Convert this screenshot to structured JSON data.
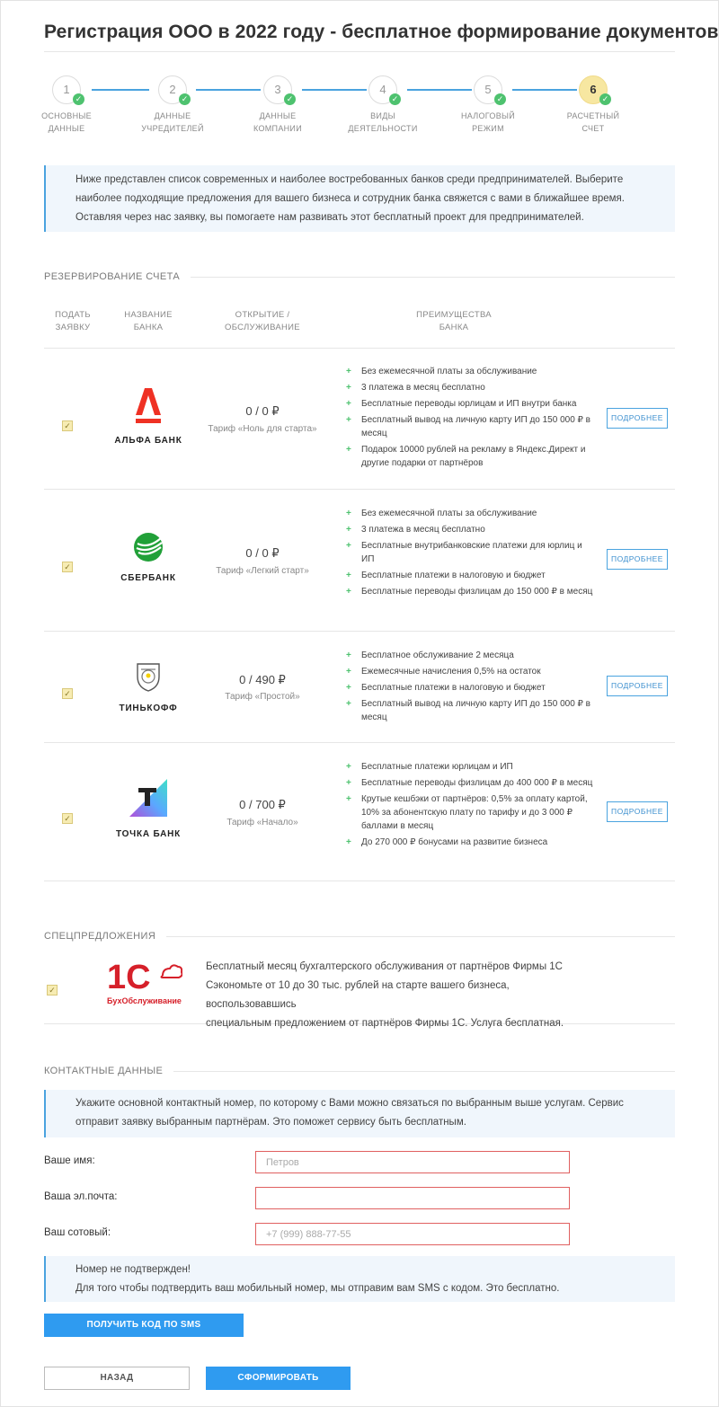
{
  "page": {
    "title": "Регистрация ООО в 2022 году - бесплатное формирование документов"
  },
  "steps": [
    {
      "num": "1",
      "label_1": "ОСНОВНЫЕ",
      "label_2": "ДАННЫЕ",
      "done": true
    },
    {
      "num": "2",
      "label_1": "ДАННЫЕ",
      "label_2": "УЧРЕДИТЕЛЕЙ",
      "done": true
    },
    {
      "num": "3",
      "label_1": "ДАННЫЕ",
      "label_2": "КОМПАНИИ",
      "done": true
    },
    {
      "num": "4",
      "label_1": "ВИДЫ",
      "label_2": "ДЕЯТЕЛЬНОСТИ",
      "done": true
    },
    {
      "num": "5",
      "label_1": "НАЛОГОВЫЙ",
      "label_2": "РЕЖИМ",
      "done": true
    },
    {
      "num": "6",
      "label_1": "РАСЧЕТНЫЙ",
      "label_2": "СЧЕТ",
      "done": true,
      "active": true
    }
  ],
  "intro": {
    "line_1": "Ниже представлен список современных и наиболее востребованных банков среди предпринимателей. Выберите",
    "line_2": "наиболее подходящие предложения для вашего бизнеса и сотрудник банка свяжется с вами в ближайшее время.",
    "line_3": "Оставляя через нас заявку, вы помогаете нам развивать этот бесплатный проект для предпринимателей."
  },
  "reservation": {
    "heading": "РЕЗЕРВИРОВАНИЕ СЧЕТА",
    "columns": {
      "apply_1": "ПОДАТЬ",
      "apply_2": "ЗАЯВКУ",
      "bank_1": "НАЗВАНИЕ",
      "bank_2": "БАНКА",
      "open_1": "ОТКРЫТИЕ /",
      "open_2": "ОБСЛУЖИВАНИЕ",
      "adv_1": "ПРЕИМУЩЕСТВА",
      "adv_2": "БАНКА"
    },
    "more_label": "ПОДРОБНЕЕ",
    "banks": [
      {
        "name": "АЛЬФА БАНК",
        "logo_icon": "alfa-bank-logo",
        "price": "0 / 0 ₽",
        "tariff": "Тариф «Ноль для старта»",
        "checked": true,
        "advantages": [
          "Без ежемесячной платы за обслуживание",
          "3 платежа в месяц бесплатно",
          "Бесплатные переводы юрлицам и ИП внутри банка",
          "Бесплатный вывод на личную карту ИП до 150 000 ₽ в месяц",
          "Подарок 10000 рублей на рекламу в Яндекс.Директ и другие подарки от партнёров"
        ]
      },
      {
        "name": "СБЕРБАНК",
        "logo_icon": "sberbank-logo",
        "price": "0 / 0 ₽",
        "tariff": "Тариф «Легкий старт»",
        "checked": true,
        "advantages": [
          "Без ежемесячной платы за обслуживание",
          "3 платежа в месяц бесплатно",
          "Бесплатные внутрибанковские платежи для юрлиц и ИП",
          "Бесплатные платежи в налоговую и бюджет",
          "Бесплатные переводы физлицам до 150 000 ₽ в месяц"
        ]
      },
      {
        "name": "ТИНЬКОФФ",
        "logo_icon": "tinkoff-logo",
        "price": "0 / 490 ₽",
        "tariff": "Тариф «Простой»",
        "checked": true,
        "advantages": [
          "Бесплатное обслуживание 2 месяца",
          "Ежемесячные начисления 0,5% на остаток",
          "Бесплатные платежи в налоговую и бюджет",
          "Бесплатный вывод на личную карту ИП до 150 000 ₽ в месяц"
        ]
      },
      {
        "name": "ТОЧКА БАНК",
        "logo_icon": "tochka-bank-logo",
        "price": "0 / 700 ₽",
        "tariff": "Тариф «Начало»",
        "checked": true,
        "advantages": [
          "Бесплатные платежи юрлицам и ИП",
          "Бесплатные переводы физлицам до 400 000 ₽ в месяц",
          "Крутые кешбэки от партнёров: 0,5% за оплату картой, 10% за абонентскую плату по тарифу и до 3 000 ₽ баллами в месяц",
          "До 270 000 ₽ бонусами на развитие бизнеса"
        ]
      }
    ]
  },
  "special": {
    "heading": "СПЕЦПРЕДЛОЖЕНИЯ",
    "logo_main": "1С",
    "logo_sub": "БухОбслуживание",
    "checked": true,
    "line_1": "Бесплатный месяц бухгалтерского обслуживания от партнёров Фирмы 1С",
    "line_2": "Сэкономьте от 10 до 30 тыс. рублей на старте вашего бизнеса, воспользовавшись",
    "line_3": "специальным предложением от партнёров Фирмы 1С. Услуга бесплатная."
  },
  "contacts": {
    "heading": "КОНТАКТНЫЕ ДАННЫЕ",
    "info_1": "Укажите основной контактный номер, по которому с Вами можно связаться по выбранным выше услугам. Сервис",
    "info_2": "отправит заявку выбранным партнёрам. Это поможет сервису быть бесплатным.",
    "name_label": "Ваше имя:",
    "name_placeholder": "Петров",
    "email_label": "Ваша эл.почта:",
    "email_placeholder": "",
    "phone_label": "Ваш сотовый:",
    "phone_placeholder": "+7 (999) 888-77-55",
    "notice_1": "Номер не подтвержден!",
    "notice_2": "Для того чтобы подтвердить ваш мобильный номер, мы отправим вам SMS с кодом. Это бесплатно.",
    "sms_button": "ПОЛУЧИТЬ КОД ПО SMS"
  },
  "footer": {
    "back_button": "НАЗАД",
    "submit_button": "СФОРМИРОВАТЬ"
  },
  "colors": {
    "accent": "#2f9bf0",
    "check_green": "#4ec26f",
    "active_step": "#f7e7a1",
    "error_border": "#e06060"
  }
}
